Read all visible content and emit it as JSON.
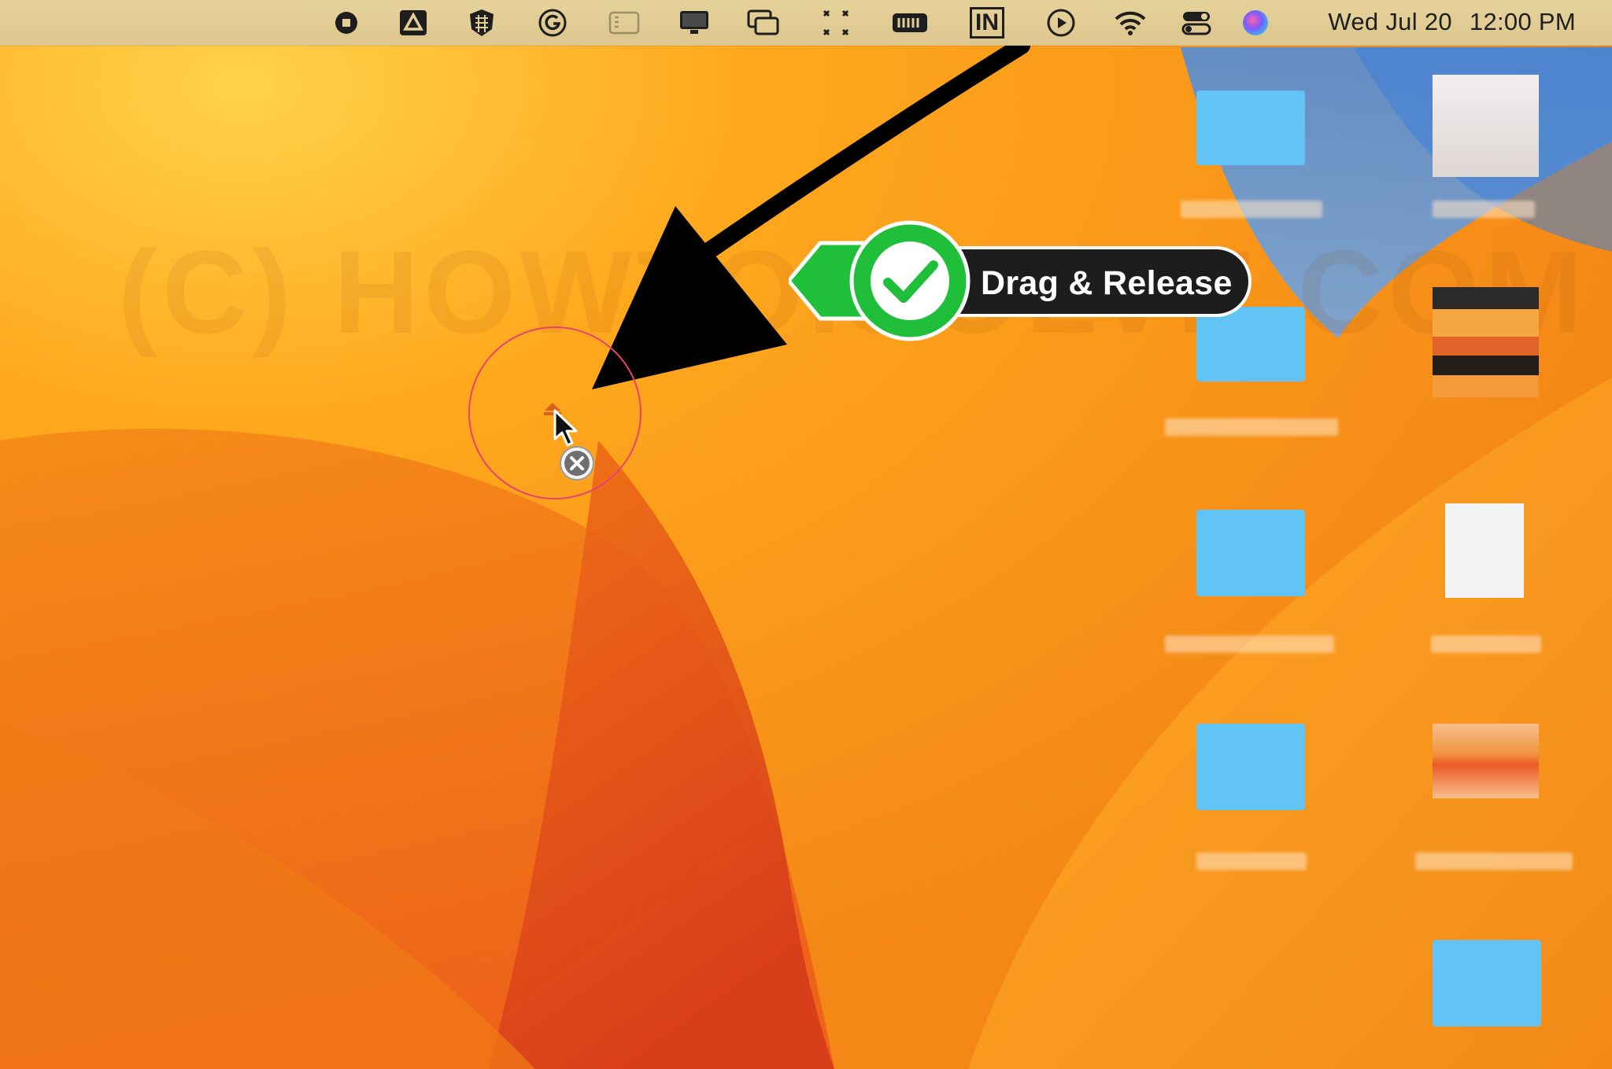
{
  "menubar": {
    "icons": [
      "record-icon",
      "google-drive-icon",
      "grid-app-icon",
      "grammarly-icon",
      "sidebar-icon",
      "display-icon",
      "window-switch-icon",
      "fullscreen-icon",
      "battery-meter-icon",
      "input-source-icon",
      "play-icon",
      "wifi-icon",
      "control-center-icon",
      "siri-icon"
    ],
    "input_label": "IN",
    "date": "Wed Jul 20",
    "time": "12:00 PM"
  },
  "watermark": "(C) HOWTOISOLVE.COM",
  "callout": {
    "label": "Drag & Release",
    "accent": "#1fbf3a"
  },
  "colors": {
    "wallpaper_main": "#f7a21c",
    "wallpaper_deep": "#e9541c",
    "folder_blue": "#5fc3f4"
  }
}
